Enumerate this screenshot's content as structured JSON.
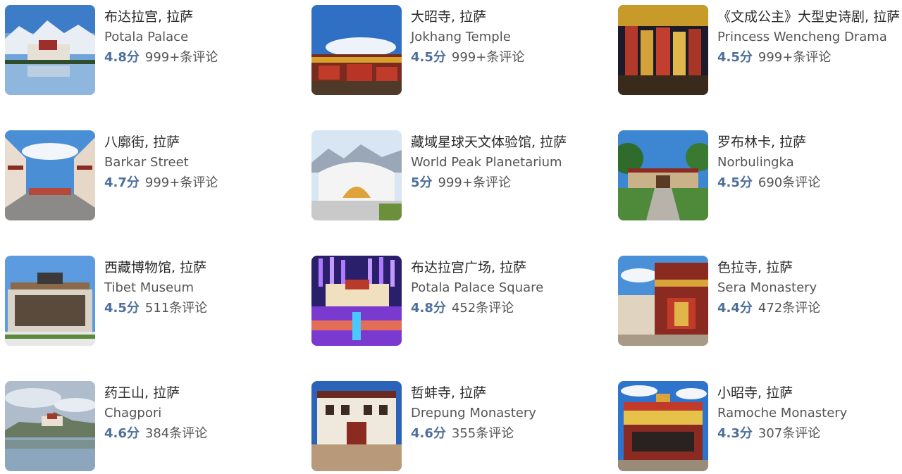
{
  "attractions": [
    {
      "title": "布达拉宫, 拉萨",
      "subtitle": "Potala Palace",
      "score": "4.8分",
      "reviews": "999+条评论"
    },
    {
      "title": "大昭寺, 拉萨",
      "subtitle": "Jokhang Temple",
      "score": "4.5分",
      "reviews": "999+条评论"
    },
    {
      "title": "《文成公主》大型史诗剧, 拉萨",
      "subtitle": "Princess Wencheng Drama",
      "score": "4.5分",
      "reviews": "999+条评论"
    },
    {
      "title": "八廓街, 拉萨",
      "subtitle": "Barkar Street",
      "score": "4.7分",
      "reviews": "999+条评论"
    },
    {
      "title": "藏域星球天文体验馆, 拉萨",
      "subtitle": "World Peak Planetarium",
      "score": "5分",
      "reviews": "999+条评论"
    },
    {
      "title": "罗布林卡, 拉萨",
      "subtitle": "Norbulingka",
      "score": "4.5分",
      "reviews": "690条评论"
    },
    {
      "title": "西藏博物馆, 拉萨",
      "subtitle": "Tibet Museum",
      "score": "4.5分",
      "reviews": "511条评论"
    },
    {
      "title": "布达拉宫广场, 拉萨",
      "subtitle": "Potala Palace Square",
      "score": "4.8分",
      "reviews": "452条评论"
    },
    {
      "title": "色拉寺, 拉萨",
      "subtitle": "Sera Monastery",
      "score": "4.4分",
      "reviews": "472条评论"
    },
    {
      "title": "药王山, 拉萨",
      "subtitle": "Chagpori",
      "score": "4.6分",
      "reviews": "384条评论"
    },
    {
      "title": "哲蚌寺, 拉萨",
      "subtitle": "Drepung Monastery",
      "score": "4.6分",
      "reviews": "355条评论"
    },
    {
      "title": "小昭寺, 拉萨",
      "subtitle": "Ramoche Monastery",
      "score": "4.3分",
      "reviews": "307条评论"
    }
  ],
  "colors": {
    "score": "#4e6f9b",
    "title": "#2a2a2a",
    "text": "#555555"
  }
}
